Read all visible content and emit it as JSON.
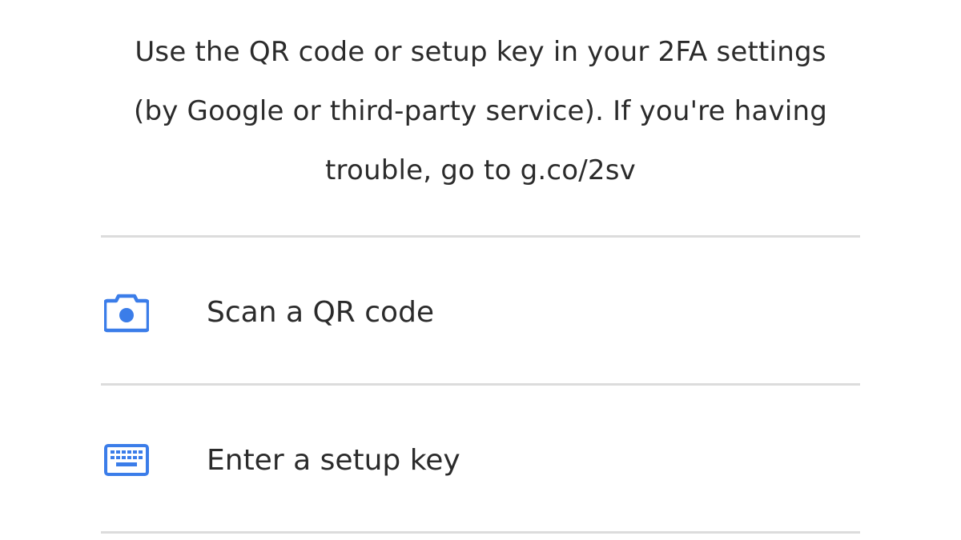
{
  "instructions": {
    "line1": "Use the QR code or setup key in your 2FA settings",
    "line2": "(by Google or third-party service). If you're having",
    "line3": "trouble, go to g.co/2sv"
  },
  "options": [
    {
      "label": "Scan a QR code",
      "icon": "camera-icon"
    },
    {
      "label": "Enter a setup key",
      "icon": "keyboard-icon"
    }
  ],
  "colors": {
    "accent": "#3b7de9",
    "divider": "#dcdcdc",
    "text": "#2b2b2b"
  }
}
